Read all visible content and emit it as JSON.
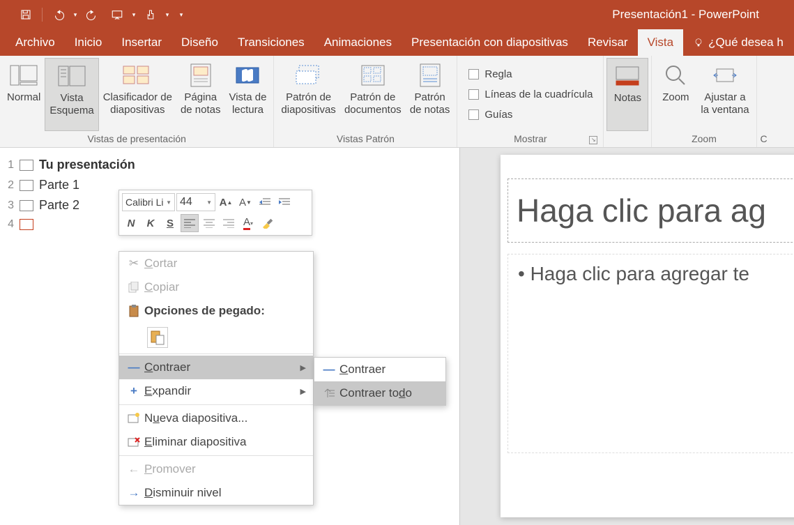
{
  "title": "Presentación1 - PowerPoint",
  "menubar": {
    "tabs": [
      "Archivo",
      "Inicio",
      "Insertar",
      "Diseño",
      "Transiciones",
      "Animaciones",
      "Presentación con diapositivas",
      "Revisar",
      "Vista"
    ],
    "tell_me": "¿Qué desea h"
  },
  "ribbon": {
    "views": {
      "label": "Vistas de presentación",
      "normal": "Normal",
      "outline": "Vista\nEsquema",
      "sorter": "Clasificador de\ndiapositivas",
      "notes_page": "Página\nde notas",
      "reading": "Vista de\nlectura"
    },
    "master": {
      "label": "Vistas Patrón",
      "slide": "Patrón de\ndiapositivas",
      "handout": "Patrón de\ndocumentos",
      "notes": "Patrón\nde notas"
    },
    "show": {
      "label": "Mostrar",
      "ruler": "Regla",
      "grid": "Líneas de la cuadrícula",
      "guides": "Guías"
    },
    "notes_btn": "Notas",
    "zoom": {
      "label": "Zoom",
      "zoom": "Zoom",
      "fit": "Ajustar a\nla ventana"
    }
  },
  "outline": {
    "items": [
      {
        "num": "1",
        "title": "Tu presentación"
      },
      {
        "num": "2",
        "title": "Parte 1"
      },
      {
        "num": "3",
        "title": "Parte 2"
      },
      {
        "num": "4",
        "title": ""
      }
    ]
  },
  "mini": {
    "font": "Calibri Li",
    "size": "44",
    "bold": "N",
    "italic": "K",
    "underline": "S"
  },
  "ctx": {
    "cut": "Cortar",
    "copy": "Copiar",
    "paste_opts": "Opciones de pegado:",
    "collapse": "Contraer",
    "expand": "Expandir",
    "new_slide": "Nueva diapositiva...",
    "delete_slide": "Eliminar diapositiva",
    "promote": "Promover",
    "demote": "Disminuir nivel"
  },
  "submenu": {
    "collapse": "Contraer",
    "collapse_all": "Contraer todo"
  },
  "slide": {
    "title_placeholder": "Haga clic para ag",
    "body_placeholder": "• Haga clic para agregar te"
  }
}
